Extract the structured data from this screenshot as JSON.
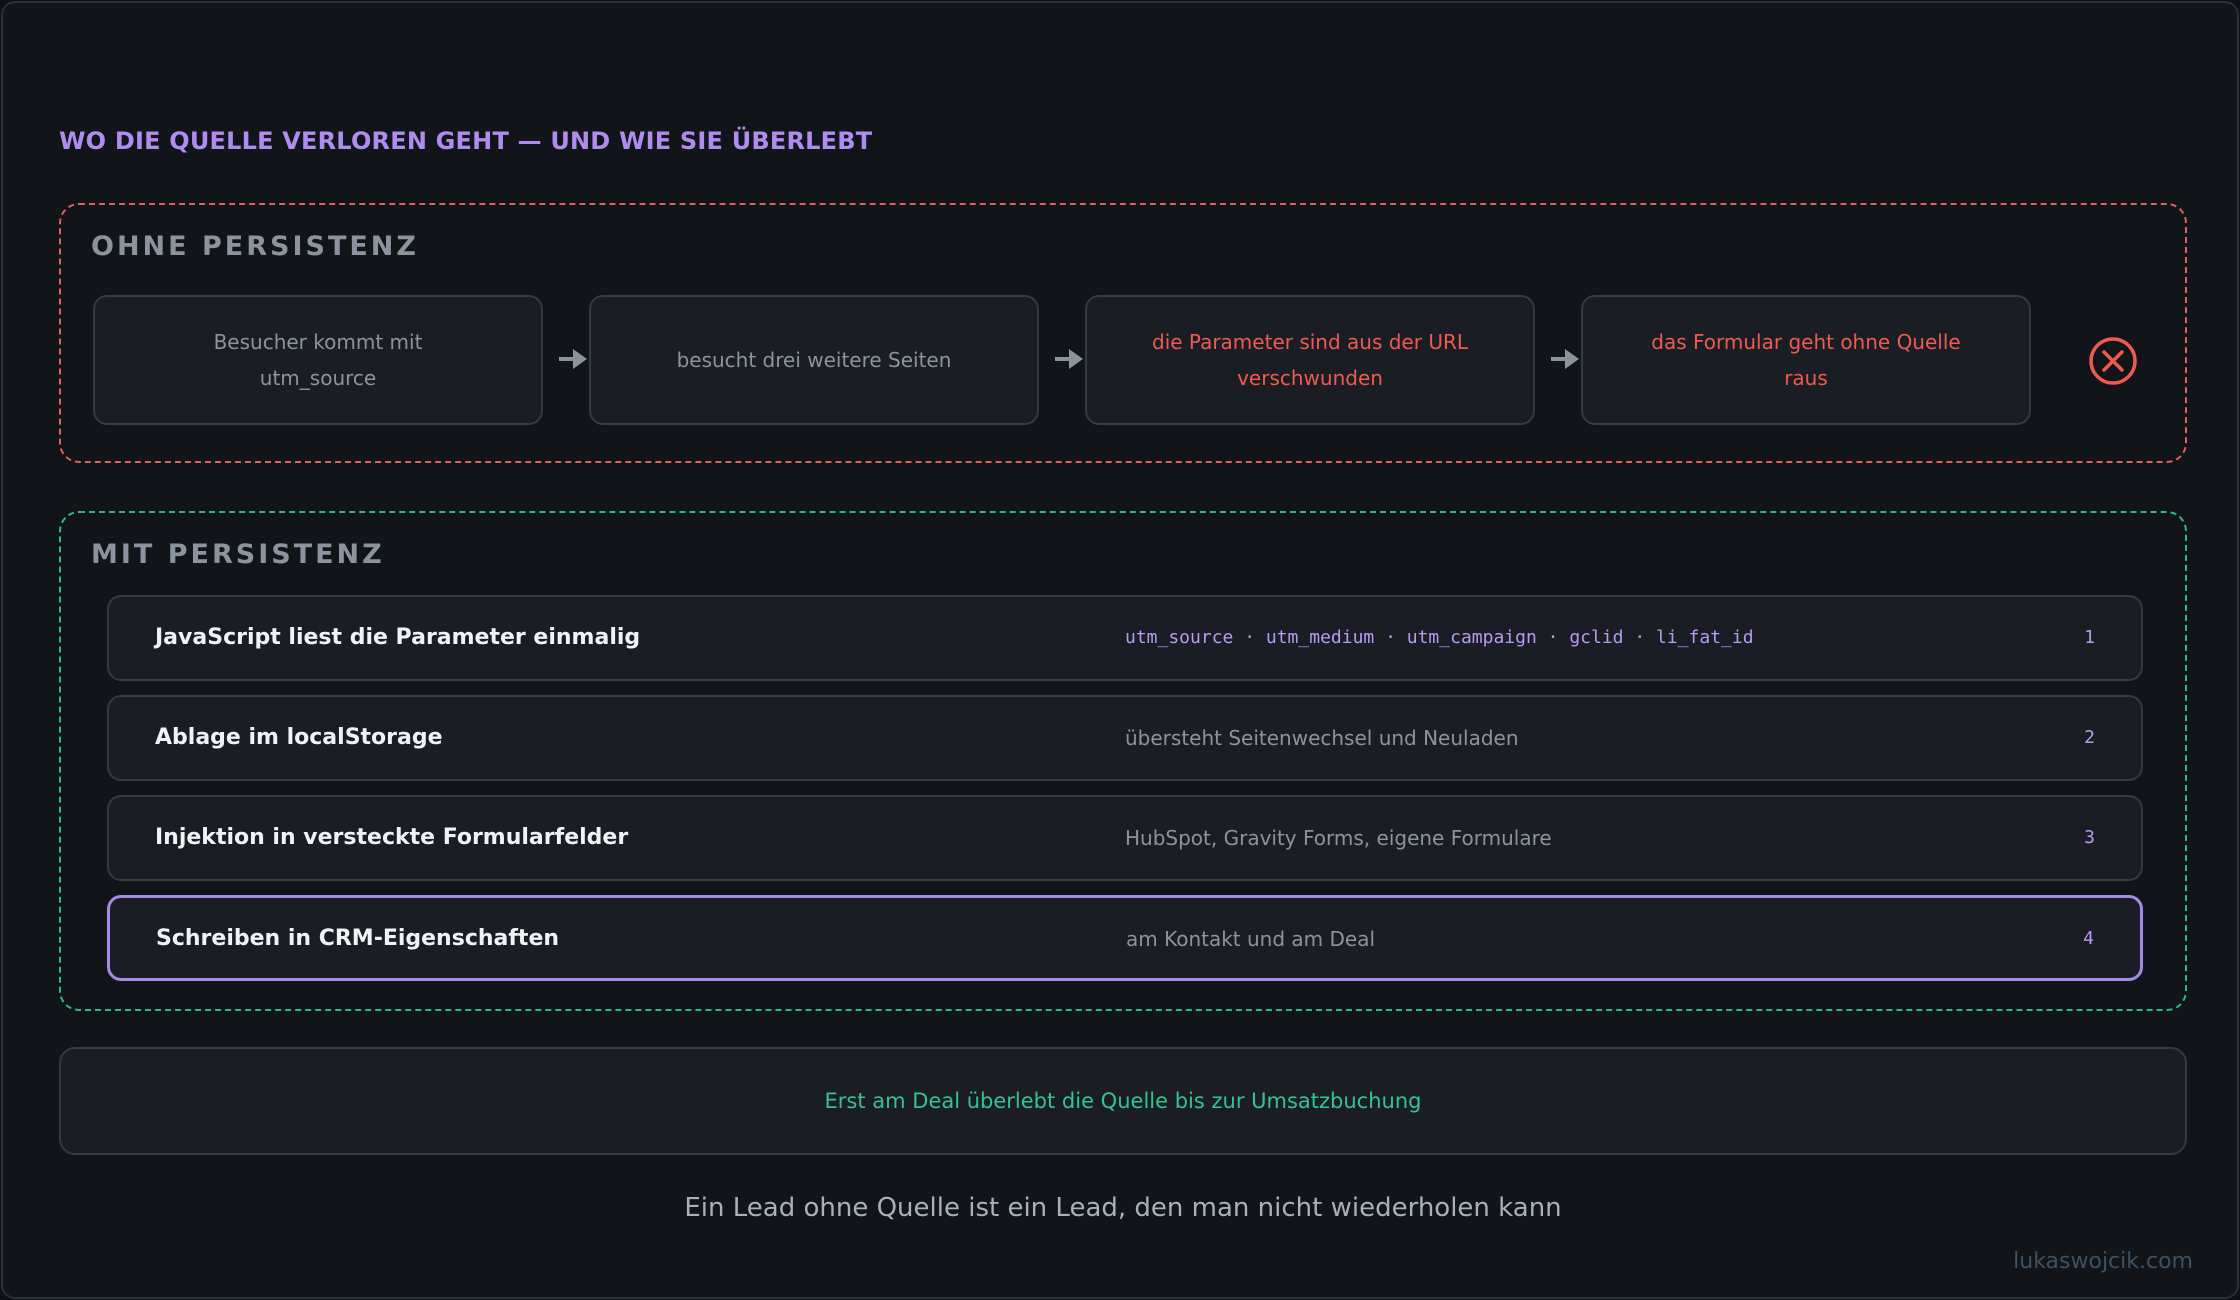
{
  "title": "WO DIE QUELLE VERLOREN GEHT — UND WIE SIE ÜBERLEBT",
  "without": {
    "label": "OHNE PERSISTENZ",
    "steps": [
      {
        "text": "Besucher kommt mit utm_source",
        "status": "neutral"
      },
      {
        "text": "besucht drei weitere Seiten",
        "status": "neutral"
      },
      {
        "text": "die Parameter sind aus der URL verschwunden",
        "status": "warning"
      },
      {
        "text": "das Formular geht ohne Quelle raus",
        "status": "warning"
      }
    ],
    "end_icon": "x-circle-icon"
  },
  "with": {
    "label": "MIT PERSISTENZ",
    "rows": [
      {
        "title": "JavaScript liest die Parameter einmalig",
        "desc": "utm_source · utm_medium · utm_campaign · gclid · li_fat_id",
        "num": "1"
      },
      {
        "title": "Ablage im localStorage",
        "desc": "übersteht Seitenwechsel und Neuladen",
        "num": "2"
      },
      {
        "title": "Injektion in versteckte Formularfelder",
        "desc": "HubSpot, Gravity Forms, eigene Formulare",
        "num": "3"
      },
      {
        "title": "Schreiben in CRM-Eigenschaften",
        "desc": "am Kontakt und am Deal",
        "num": "4"
      }
    ]
  },
  "summary": "Erst am Deal überlebt die Quelle bis zur Umsatzbuchung",
  "footer": "Ein Lead ohne Quelle ist ein Lead, den man nicht wiederholen kann",
  "credit": "lukaswojcik.com",
  "colors": {
    "accent": "#b18cf0",
    "warning": "#ef5a4f",
    "success": "#34c38f",
    "background": "#111418"
  }
}
